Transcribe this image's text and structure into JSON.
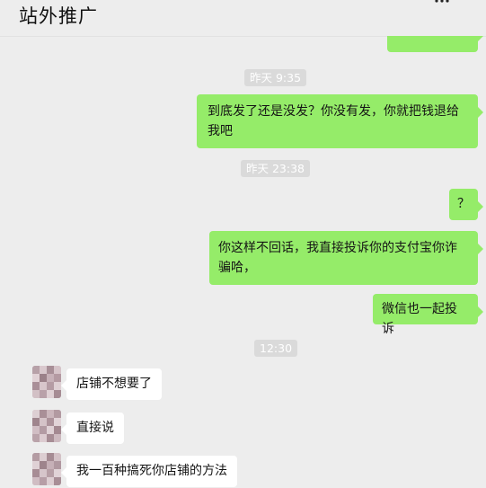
{
  "header": {
    "title": "站外推广",
    "more_icon": "more-dots-icon"
  },
  "colors": {
    "background": "#ededed",
    "self_bubble": "#95ec69",
    "other_bubble": "#ffffff",
    "timestamp_bg": "#dadada"
  },
  "chat": {
    "timestamps": [
      "昨天 9:35",
      "昨天 23:38",
      "12:30"
    ],
    "sent": [
      "到底发了还是没发？你没有发，你就把钱退给我吧",
      "？",
      "你这样不回话，我直接投诉你的支付宝你诈骗哈，",
      "微信也一起投诉"
    ],
    "received": [
      "店铺不想要了",
      "直接说",
      "我一百种搞死你店铺的方法"
    ]
  }
}
